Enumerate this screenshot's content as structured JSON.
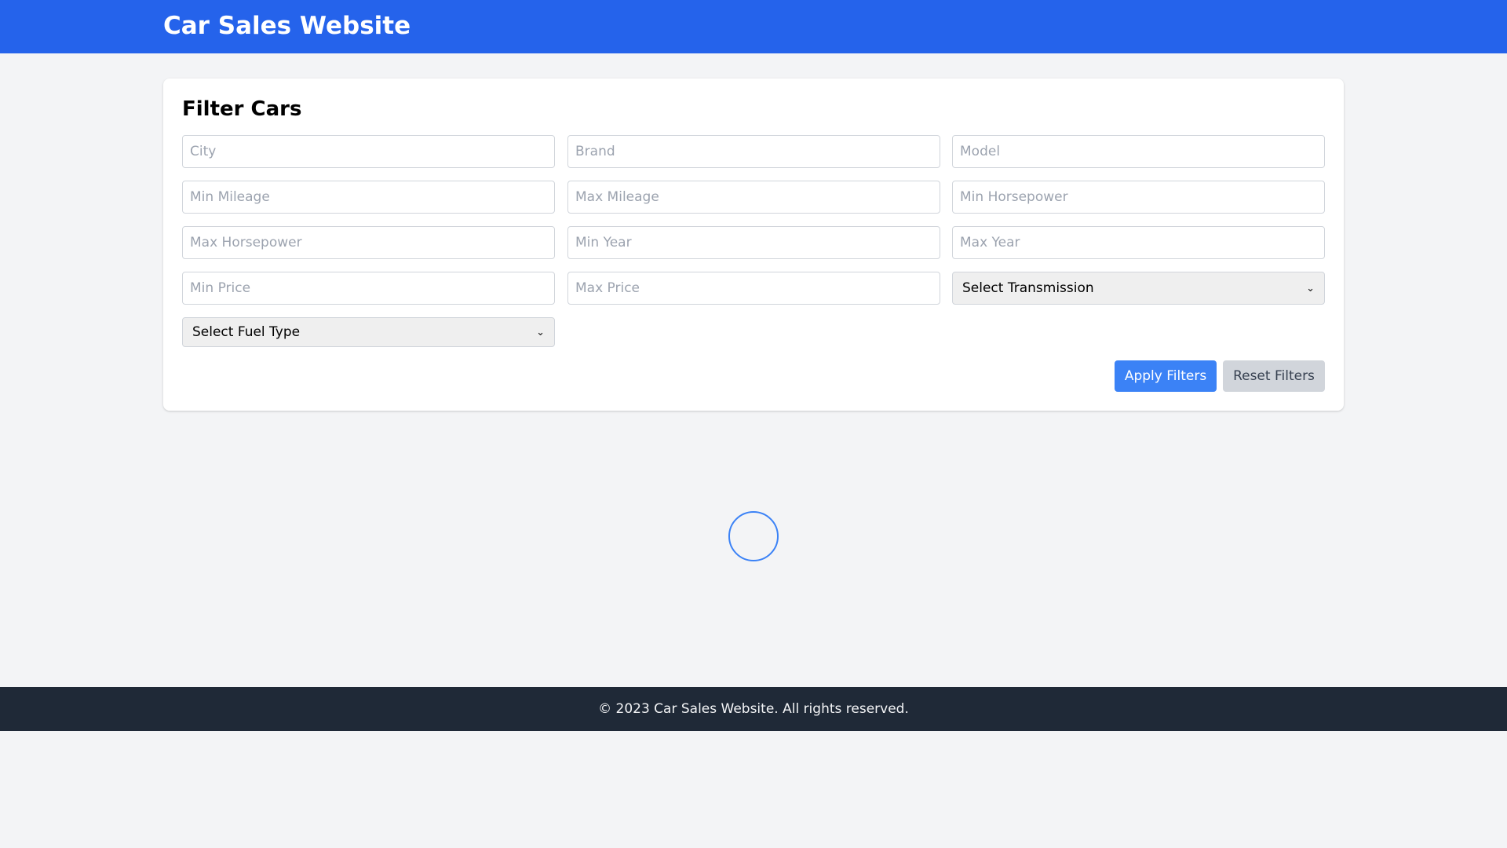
{
  "header": {
    "title": "Car Sales Website"
  },
  "filter": {
    "title": "Filter Cars",
    "fields": {
      "city": "City",
      "brand": "Brand",
      "model": "Model",
      "min_mileage": "Min Mileage",
      "max_mileage": "Max Mileage",
      "min_horsepower": "Min Horsepower",
      "max_horsepower": "Max Horsepower",
      "min_year": "Min Year",
      "max_year": "Max Year",
      "min_price": "Min Price",
      "max_price": "Max Price"
    },
    "transmission_select": "Select Transmission",
    "fuel_type_select": "Select Fuel Type",
    "apply_label": "Apply Filters",
    "reset_label": "Reset Filters"
  },
  "colors": {
    "header_bg": "#2563eb",
    "apply_bg": "#3b82f6",
    "reset_bg": "#d1d5db",
    "footer_bg": "#1f2937"
  },
  "footer": {
    "text": "© 2023 Car Sales Website. All rights reserved."
  }
}
